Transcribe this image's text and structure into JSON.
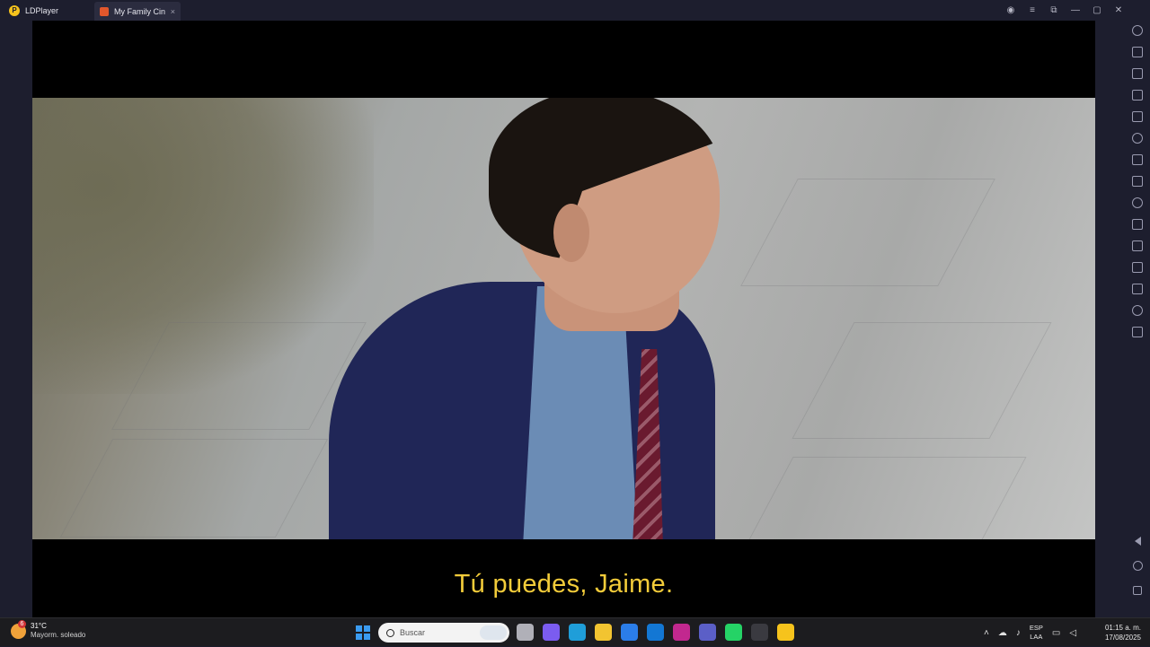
{
  "titlebar": {
    "app_name": "LDPlayer",
    "tab_title": "My Family Cin...",
    "tab_close_glyph": "×",
    "controls": [
      "person-icon",
      "menu-icon",
      "restore-icon",
      "minimize-icon",
      "maximize-icon",
      "close-icon"
    ]
  },
  "player": {
    "subtitle": "Tú puedes, Jaime."
  },
  "sidebar_tools": [
    "gamepad-icon",
    "keyboard-icon",
    "volume-up-icon",
    "volume-down-icon",
    "screenshot-icon",
    "settings-icon",
    "window-icon",
    "robot-icon",
    "scissors-icon",
    "record-icon",
    "sync-icon",
    "apk-icon",
    "folder-icon",
    "location-icon",
    "multi-instance-icon"
  ],
  "navigation": [
    "back-icon",
    "home-icon",
    "recent-apps-icon"
  ],
  "taskbar": {
    "weather_badge": "6",
    "weather_temp": "31°C",
    "weather_desc": "Mayorm. soleado",
    "search_placeholder": "Buscar",
    "pinned_apps": [
      {
        "name": "task-view",
        "color": "#b0b0b8"
      },
      {
        "name": "copilot",
        "color": "#7b5cf0"
      },
      {
        "name": "edge",
        "color": "#1f9ed9"
      },
      {
        "name": "file-explorer",
        "color": "#f2c431"
      },
      {
        "name": "store",
        "color": "#2b7de9"
      },
      {
        "name": "outlook",
        "color": "#1377d4"
      },
      {
        "name": "app-active",
        "color": "#c2288f"
      },
      {
        "name": "teams",
        "color": "#5b5fc7"
      },
      {
        "name": "whatsapp",
        "color": "#25d366"
      },
      {
        "name": "media-app",
        "color": "#3a3a40"
      },
      {
        "name": "ldplayer",
        "color": "#f6c31c"
      }
    ],
    "lang_top": "ESP",
    "lang_bottom": "LAA",
    "time": "01:15 a. m.",
    "date": "17/08/2025"
  }
}
